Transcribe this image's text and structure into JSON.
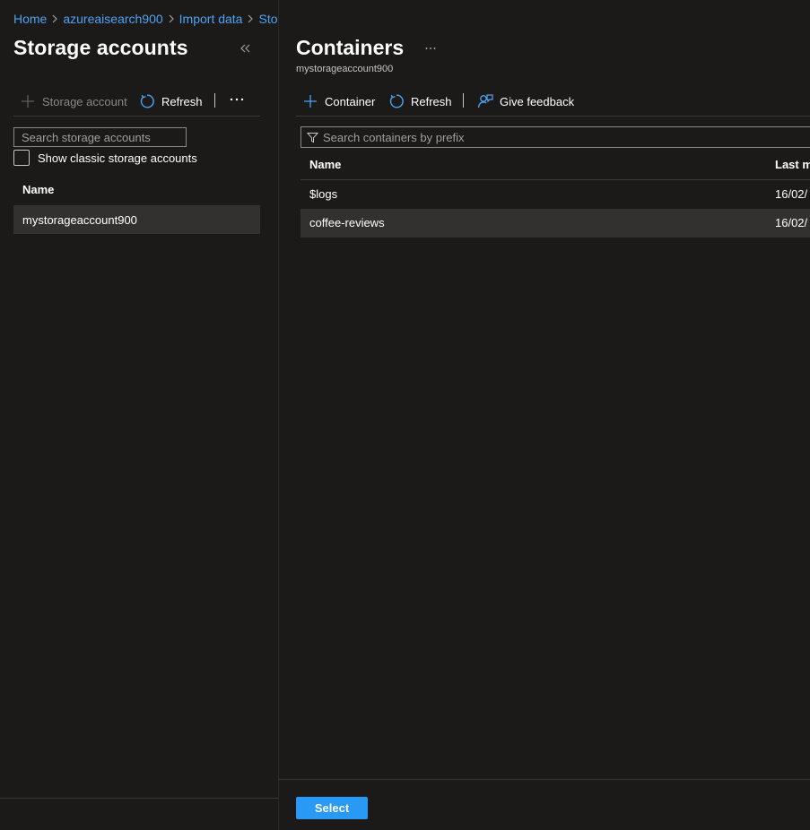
{
  "breadcrumb": {
    "items": [
      {
        "label": "Home"
      },
      {
        "label": "azureaisearch900"
      },
      {
        "label": "Import data"
      },
      {
        "label": "Storage accounts"
      }
    ]
  },
  "left_pane": {
    "title": "Storage accounts",
    "toolbar": {
      "add_label": "Storage account",
      "refresh_label": "Refresh"
    },
    "search": {
      "placeholder": "Search storage accounts",
      "value": ""
    },
    "classic_checkbox": {
      "label": "Show classic storage accounts",
      "checked": false
    },
    "table": {
      "header": "Name",
      "rows": [
        {
          "name": "mystorageaccount900",
          "selected": true
        }
      ]
    }
  },
  "right_pane": {
    "title": "Containers",
    "subtitle": "mystorageaccount900",
    "toolbar": {
      "container_label": "Container",
      "refresh_label": "Refresh",
      "feedback_label": "Give feedback"
    },
    "filter": {
      "placeholder": "Search containers by prefix",
      "value": ""
    },
    "table": {
      "headers": {
        "name": "Name",
        "modified": "Last m"
      },
      "rows": [
        {
          "name": "$logs",
          "modified": "16/02/",
          "selected": false
        },
        {
          "name": "coffee-reviews",
          "modified": "16/02/",
          "selected": true
        }
      ]
    },
    "select_button": "Select"
  },
  "colors": {
    "background": "#1b1a19",
    "accent": "#2899f5",
    "link": "#4ea3f1",
    "selected_row": "#323130"
  },
  "icons": [
    "chevron-right-icon",
    "collapse-icon",
    "add-icon",
    "refresh-icon",
    "more-icon",
    "filter-icon",
    "feedback-icon"
  ]
}
